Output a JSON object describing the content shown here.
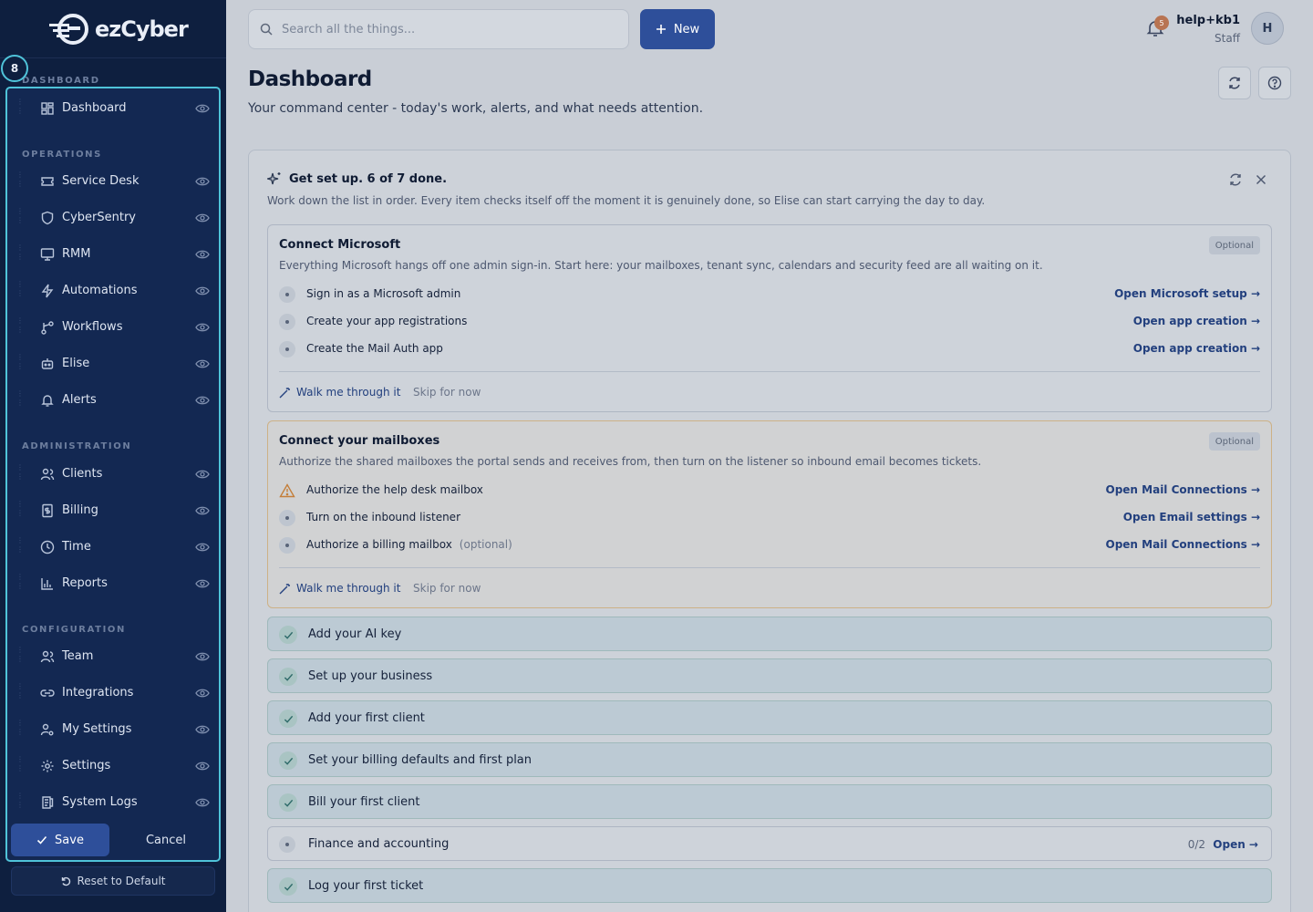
{
  "brand": {
    "logo_text": "ezCyber"
  },
  "sidebar": {
    "step_number": "8",
    "groups": [
      {
        "label": "DASHBOARD",
        "items": [
          {
            "label": "Dashboard",
            "icon": "grid-icon"
          }
        ]
      },
      {
        "label": "OPERATIONS",
        "items": [
          {
            "label": "Service Desk",
            "icon": "ticket-icon"
          },
          {
            "label": "CyberSentry",
            "icon": "shield-icon"
          },
          {
            "label": "RMM",
            "icon": "monitor-icon"
          },
          {
            "label": "Automations",
            "icon": "bolt-icon"
          },
          {
            "label": "Workflows",
            "icon": "branch-icon"
          },
          {
            "label": "Elise",
            "icon": "bot-icon"
          },
          {
            "label": "Alerts",
            "icon": "bell-icon"
          }
        ]
      },
      {
        "label": "ADMINISTRATION",
        "items": [
          {
            "label": "Clients",
            "icon": "users-icon"
          },
          {
            "label": "Billing",
            "icon": "receipt-icon"
          },
          {
            "label": "Time",
            "icon": "clock-icon"
          },
          {
            "label": "Reports",
            "icon": "bar-chart-icon"
          }
        ]
      },
      {
        "label": "CONFIGURATION",
        "items": [
          {
            "label": "Team",
            "icon": "users-icon"
          },
          {
            "label": "Integrations",
            "icon": "link-icon"
          },
          {
            "label": "My Settings",
            "icon": "user-cog-icon"
          },
          {
            "label": "Settings",
            "icon": "gear-icon"
          },
          {
            "label": "System Logs",
            "icon": "logs-icon"
          }
        ]
      }
    ],
    "save_label": "Save",
    "cancel_label": "Cancel",
    "reset_label": "Reset to Default"
  },
  "topbar": {
    "search_placeholder": "Search all the things...",
    "new_label": "New",
    "notification_count": "5",
    "user_name": "help+kb1",
    "user_role": "Staff",
    "avatar_initial": "H"
  },
  "page": {
    "title": "Dashboard",
    "subtitle": "Your command center - today's work, alerts, and what needs attention."
  },
  "setup": {
    "title": "Get set up. 6 of 7 done.",
    "description": "Work down the list in order. Every item checks itself off the moment it is genuinely done, so Elise can start carrying the day to day.",
    "microsoft": {
      "title": "Connect Microsoft",
      "badge": "Optional",
      "description": "Everything Microsoft hangs off one admin sign-in. Start here: your mailboxes, tenant sync, calendars and security feed are all waiting on it.",
      "steps": [
        {
          "label": "Sign in as a Microsoft admin",
          "link": "Open Microsoft setup →"
        },
        {
          "label": "Create your app registrations",
          "link": "Open app creation →"
        },
        {
          "label": "Create the Mail Auth app",
          "link": "Open app creation →"
        }
      ],
      "walk_label": "Walk me through it",
      "skip_label": "Skip for now"
    },
    "mailboxes": {
      "title": "Connect your mailboxes",
      "badge": "Optional",
      "description": "Authorize the shared mailboxes the portal sends and receives from, then turn on the listener so inbound email becomes tickets.",
      "steps": [
        {
          "label": "Authorize the help desk mailbox",
          "link": "Open Mail Connections →",
          "optional": ""
        },
        {
          "label": "Turn on the inbound listener",
          "link": "Open Email settings →",
          "optional": ""
        },
        {
          "label": "Authorize a billing mailbox",
          "link": "Open Mail Connections →",
          "optional": "(optional)"
        }
      ],
      "walk_label": "Walk me through it",
      "skip_label": "Skip for now"
    },
    "done_items": [
      "Add your AI key",
      "Set up your business",
      "Add your first client",
      "Set your billing defaults and first plan",
      "Bill your first client"
    ],
    "finance": {
      "label": "Finance and accounting",
      "count": "0/2",
      "link": "Open →"
    },
    "last_item": "Log your first ticket"
  },
  "colors": {
    "sidebar_bg": "#0e1f3f",
    "accent": "#2e4f9a",
    "highlight": "#4fc3d9",
    "warning": "#c47f3a"
  }
}
